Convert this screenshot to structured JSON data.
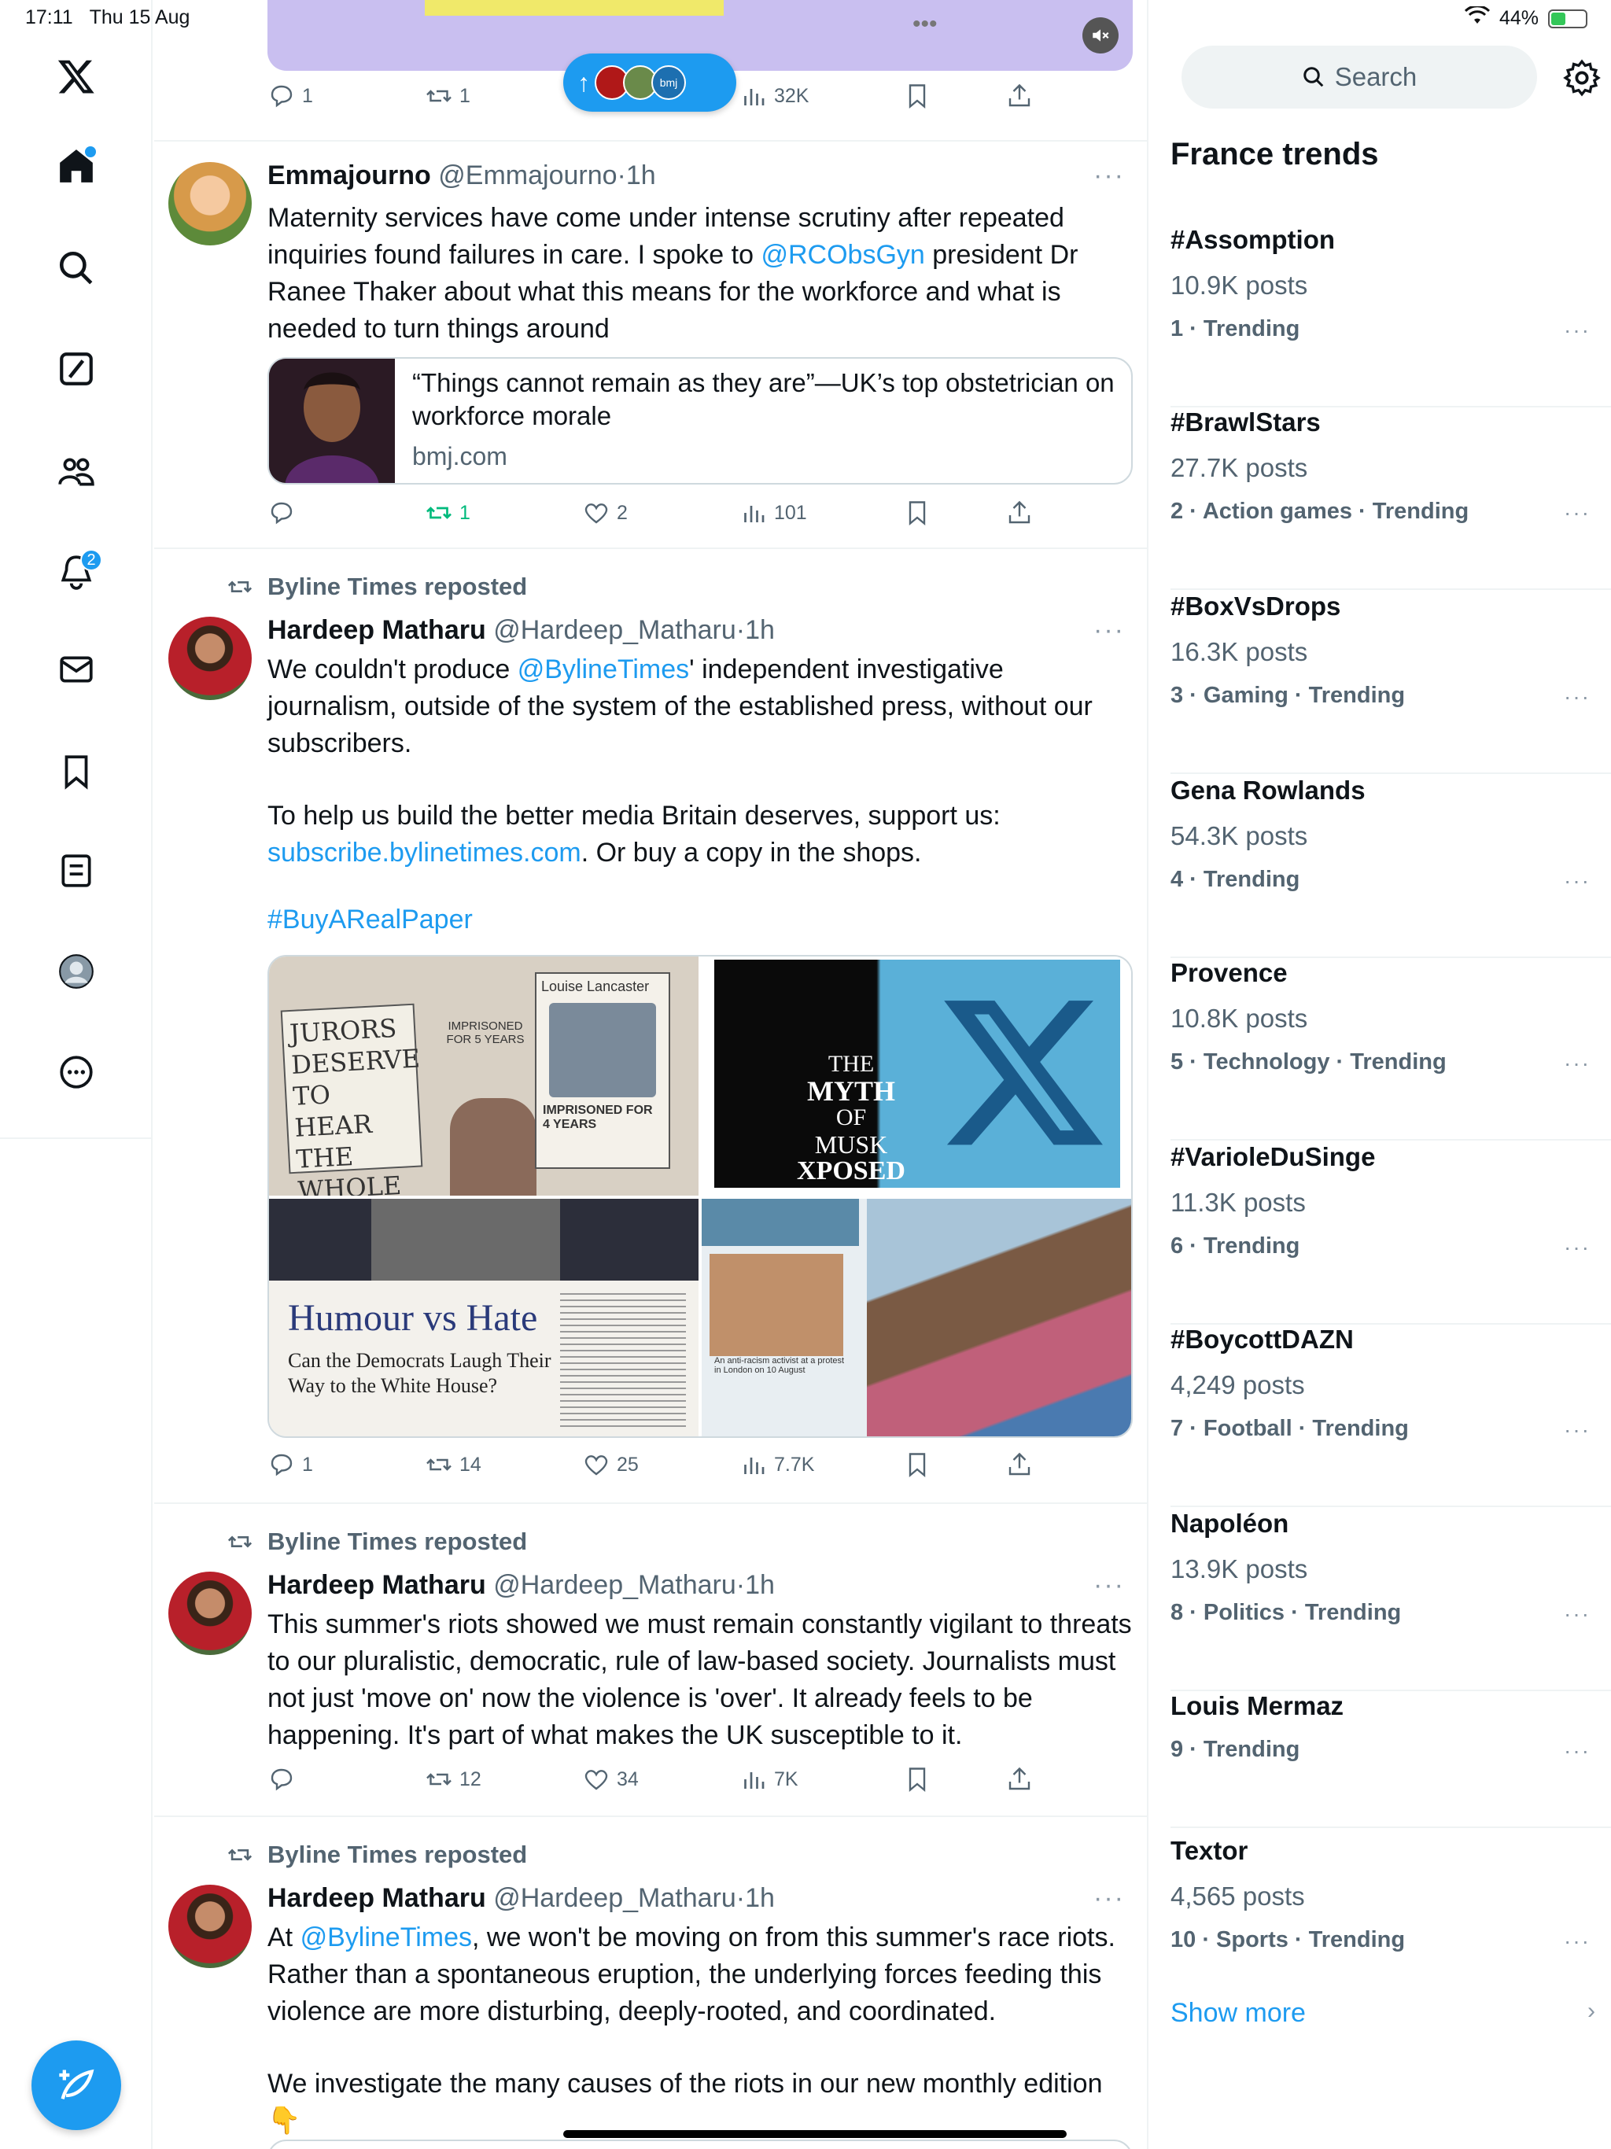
{
  "status_bar": {
    "time": "17:11",
    "date": "Thu 15 Aug",
    "battery": "44%",
    "battery_level": 0.44
  },
  "nav": {
    "logo": "x-logo-icon",
    "notifications_badge": "2",
    "items": [
      "home-icon",
      "search-icon",
      "grok-icon",
      "communities-icon",
      "notifications-icon",
      "messages-icon",
      "bookmarks-icon",
      "lists-icon",
      "profile-icon",
      "more-icon"
    ]
  },
  "top_post": {
    "reply_count": "1",
    "repost_count": "1",
    "views": "32K"
  },
  "pill": {
    "arrow": "↑",
    "label": "bmj"
  },
  "posts": [
    {
      "author_name": "Emmajourno",
      "author_handle": "@Emmajourno",
      "time": "1h",
      "text_parts": [
        "Maternity services have come under intense scrutiny after repeated inquiries found failures in care. I spoke to ",
        "@RCObsGyn",
        " president Dr Ranee Thaker about what this means for the workforce and what is needed to turn things around"
      ],
      "card": {
        "title": "“Things cannot remain as they are”—UK’s top obstetrician on workforce morale",
        "domain": "bmj.com"
      },
      "stats": {
        "replies": "",
        "reposts": "1",
        "likes": "2",
        "views": "101"
      }
    },
    {
      "reposted_by": "Byline Times reposted",
      "author_name": "Hardeep Matharu",
      "author_handle": "@Hardeep_Matharu",
      "time": "1h",
      "line1_a": "We couldn't produce ",
      "line1_link": "@BylineTimes",
      "line1_b": "' independent investigative journalism, outside of the system of the established press, without our subscribers.",
      "line2_a": "To help us build the better media Britain deserves, support us: ",
      "line2_link": "subscribe.bylinetimes.com",
      "line2_b": ". Or buy a copy in the shops.",
      "hashtag": "#BuyARealPaper",
      "media": {
        "jurors_sign": "JURORS DESERVE TO HEAR THE WHOLE TRUTH",
        "imprisoned_5": "IMPRISONED FOR 5 YEARS",
        "louise": "Louise Lancaster",
        "imprisoned_4": "IMPRISONED FOR 4 YEARS",
        "myth_1": "THE",
        "myth_2": "MYTH",
        "myth_3": "OF",
        "myth_4": "MUSK",
        "myth_5": "XPOSED",
        "humour_title": "Humour vs Hate",
        "humour_sub": "Can the Democrats Laugh Their Way to the White House?",
        "antiracism_caption": "An anti-racism activist at a protest in London on 10 August"
      },
      "stats": {
        "replies": "1",
        "reposts": "14",
        "likes": "25",
        "views": "7.7K"
      }
    },
    {
      "reposted_by": "Byline Times reposted",
      "author_name": "Hardeep Matharu",
      "author_handle": "@Hardeep_Matharu",
      "time": "1h",
      "text": "This summer's riots showed we must remain constantly vigilant to threats to our pluralistic, democratic, rule of law-based society. Journalists must not just 'move on' now the violence is 'over'. It already feels to be happening.  It's part of what makes the UK susceptible to it.",
      "stats": {
        "replies": "",
        "reposts": "12",
        "likes": "34",
        "views": "7K"
      }
    },
    {
      "reposted_by": "Byline Times reposted",
      "author_name": "Hardeep Matharu",
      "author_handle": "@Hardeep_Matharu",
      "time": "1h",
      "line1_a": "At ",
      "line1_link": "@BylineTimes",
      "line1_b": ", we won't be moving on from this summer's race riots. Rather than a spontaneous eruption, the underlying forces feeding this violence are more disturbing, deeply-rooted, and coordinated.",
      "line2": "We investigate the many causes of the riots in our new monthly edition 👇"
    }
  ],
  "right": {
    "search_placeholder": "Search",
    "trends_title": "France trends",
    "trends": [
      {
        "name": "#Assomption",
        "posts": "10.9K posts",
        "category": "1 · Trending"
      },
      {
        "name": "#BrawlStars",
        "posts": "27.7K posts",
        "category": "2 · Action games · Trending"
      },
      {
        "name": "#BoxVsDrops",
        "posts": "16.3K posts",
        "category": "3 · Gaming · Trending"
      },
      {
        "name": "Gena Rowlands",
        "posts": "54.3K posts",
        "category": "4 · Trending"
      },
      {
        "name": "Provence",
        "posts": "10.8K posts",
        "category": "5 · Technology · Trending"
      },
      {
        "name": "#VarioleDuSinge",
        "posts": "11.3K posts",
        "category": "6 · Trending"
      },
      {
        "name": "#BoycottDAZN",
        "posts": "4,249 posts",
        "category": "7 · Football · Trending"
      },
      {
        "name": "Napoléon",
        "posts": "13.9K posts",
        "category": "8 · Politics · Trending"
      },
      {
        "name": "Louis Mermaz",
        "posts": "",
        "category": "9 · Trending"
      },
      {
        "name": "Textor",
        "posts": "4,565 posts",
        "category": "10 · Sports · Trending"
      }
    ],
    "show_more": "Show more",
    "more_dots": "···"
  },
  "colors": {
    "accent": "#1d9bf0",
    "repost_green": "#00ba7c",
    "text_secondary": "#536471"
  }
}
